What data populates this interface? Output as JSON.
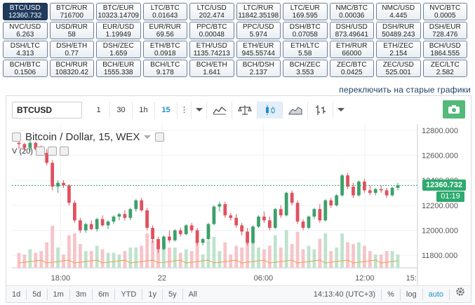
{
  "pairs": [
    [
      {
        "name": "BTC/USD",
        "value": "12360.732",
        "active": true
      },
      {
        "name": "BTC/RUR",
        "value": "716700"
      },
      {
        "name": "BTC/EUR",
        "value": "10323.14709"
      },
      {
        "name": "LTC/BTC",
        "value": "0.01643"
      },
      {
        "name": "LTC/USD",
        "value": "202.474"
      },
      {
        "name": "LTC/RUR",
        "value": "11842.35198"
      },
      {
        "name": "LTC/EUR",
        "value": "169.595"
      },
      {
        "name": "NMC/BTC",
        "value": "0.00036"
      },
      {
        "name": "NMC/USD",
        "value": "4.445"
      },
      {
        "name": "NVC/BTC",
        "value": "0.0005"
      }
    ],
    [
      {
        "name": "NVC/USD",
        "value": "6.263"
      },
      {
        "name": "USD/RUR",
        "value": "58"
      },
      {
        "name": "EUR/USD",
        "value": "1.19949"
      },
      {
        "name": "EUR/RUR",
        "value": "69.56"
      },
      {
        "name": "PPC/BTC",
        "value": "0.00048"
      },
      {
        "name": "PPC/USD",
        "value": "5.974"
      },
      {
        "name": "DSH/BTC",
        "value": "0.07058"
      },
      {
        "name": "DSH/USD",
        "value": "873.49641"
      },
      {
        "name": "DSH/RUR",
        "value": "50489.243"
      },
      {
        "name": "DSH/EUR",
        "value": "728.476"
      }
    ],
    [
      {
        "name": "DSH/LTC",
        "value": "4.313"
      },
      {
        "name": "DSH/ETH",
        "value": "0.77"
      },
      {
        "name": "DSH/ZEC",
        "value": "1.659"
      },
      {
        "name": "ETH/BTC",
        "value": "0.0918"
      },
      {
        "name": "ETH/USD",
        "value": "1135.74213"
      },
      {
        "name": "ETH/EUR",
        "value": "945.55744"
      },
      {
        "name": "ETH/LTC",
        "value": "5.58"
      },
      {
        "name": "ETH/RUR",
        "value": "66000"
      },
      {
        "name": "ETH/ZEC",
        "value": "2.154"
      },
      {
        "name": "BCH/USD",
        "value": "1864.555"
      }
    ],
    [
      {
        "name": "BCH/BTC",
        "value": "0.1506"
      },
      {
        "name": "BCH/RUR",
        "value": "108320.42"
      },
      {
        "name": "BCH/EUR",
        "value": "1555.338"
      },
      {
        "name": "BCH/LTC",
        "value": "9.178"
      },
      {
        "name": "BCH/ETH",
        "value": "1.641"
      },
      {
        "name": "BCH/DSH",
        "value": "2.137"
      },
      {
        "name": "BCH/ZEC",
        "value": "3.553"
      },
      {
        "name": "ZEC/BTC",
        "value": "0.0425"
      },
      {
        "name": "ZEC/USD",
        "value": "525.001"
      },
      {
        "name": "ZEC/LTC",
        "value": "2.582"
      }
    ]
  ],
  "old_charts_link": "переключить на старые графики",
  "toolbar": {
    "symbol": "BTCUSD",
    "intervals": [
      "1",
      "30",
      "1h",
      "15"
    ],
    "selected_interval": "15",
    "dots": "⋮"
  },
  "legend": {
    "title": "Bitcoin / Dollar, 15, WEX",
    "sub": "V (20)"
  },
  "price_axis": {
    "ticks": [
      "12800.000",
      "12600.000",
      "12400.000",
      "12200.000",
      "12000.000",
      "11800.000"
    ],
    "current_price": "12360.732",
    "countdown": "01:19"
  },
  "time_axis": {
    "ticks": [
      "18:00",
      "22",
      "06:00",
      "12:00",
      "15:"
    ]
  },
  "bottom_bar": {
    "ranges": [
      "1d",
      "5d",
      "1m",
      "3m",
      "6m",
      "YTD",
      "1y",
      "5y",
      "All"
    ],
    "clock": "14:13:40 (UTC+3)",
    "percent": "%",
    "log": "log",
    "auto": "auto"
  },
  "colors": {
    "up": "#3da06a",
    "down": "#e0515e",
    "accent": "#1e90c8",
    "active_pair": "#1f3b5e"
  },
  "chart_data": {
    "type": "candlestick",
    "ylim": [
      11700,
      12850
    ],
    "candles": [
      [
        12700,
        12720,
        12650,
        12690
      ],
      [
        12690,
        12700,
        12640,
        12660
      ],
      [
        12660,
        12720,
        12630,
        12700
      ],
      [
        12700,
        12710,
        12640,
        12650
      ],
      [
        12650,
        12680,
        12600,
        12620
      ],
      [
        12620,
        12650,
        12520,
        12540
      ],
      [
        12540,
        12560,
        12320,
        12350
      ],
      [
        12350,
        12400,
        12300,
        12380
      ],
      [
        12380,
        12400,
        12340,
        12360
      ],
      [
        12360,
        12370,
        12200,
        12220
      ],
      [
        12220,
        12240,
        12060,
        12080
      ],
      [
        12080,
        12100,
        11980,
        12000
      ],
      [
        12000,
        12060,
        11980,
        12050
      ],
      [
        12050,
        12080,
        12000,
        12010
      ],
      [
        12010,
        12100,
        11990,
        12090
      ],
      [
        12090,
        12120,
        12030,
        12040
      ],
      [
        12040,
        12080,
        12010,
        12070
      ],
      [
        12070,
        12120,
        12050,
        12110
      ],
      [
        12110,
        12140,
        12080,
        12130
      ],
      [
        12130,
        12160,
        12080,
        12100
      ],
      [
        12100,
        12180,
        12080,
        12170
      ],
      [
        12170,
        12250,
        12150,
        12240
      ],
      [
        12240,
        12260,
        12150,
        12160
      ],
      [
        12160,
        12180,
        12000,
        12020
      ],
      [
        12020,
        12040,
        11900,
        11930
      ],
      [
        11930,
        11950,
        11820,
        11850
      ],
      [
        11850,
        11960,
        11840,
        11950
      ],
      [
        11950,
        12000,
        11900,
        11920
      ],
      [
        11920,
        12010,
        11910,
        12000
      ],
      [
        12000,
        12020,
        11950,
        11970
      ],
      [
        11970,
        12050,
        11960,
        12040
      ],
      [
        12040,
        12060,
        11980,
        12000
      ],
      [
        12000,
        12020,
        11880,
        11900
      ],
      [
        11900,
        11940,
        11880,
        11930
      ],
      [
        11930,
        12060,
        11920,
        12050
      ],
      [
        12050,
        12200,
        12040,
        12190
      ],
      [
        12190,
        12230,
        12150,
        12210
      ],
      [
        12210,
        12230,
        12100,
        12120
      ],
      [
        12120,
        12140,
        12080,
        12100
      ],
      [
        12100,
        12130,
        12020,
        12040
      ],
      [
        12040,
        12060,
        11960,
        11990
      ],
      [
        11990,
        12020,
        11880,
        11900
      ],
      [
        11900,
        12040,
        11890,
        12030
      ],
      [
        12030,
        12120,
        12020,
        12110
      ],
      [
        12110,
        12150,
        12060,
        12080
      ],
      [
        12080,
        12110,
        12000,
        12020
      ],
      [
        12020,
        12180,
        12010,
        12170
      ],
      [
        12170,
        12200,
        12100,
        12120
      ],
      [
        12120,
        12310,
        12110,
        12300
      ],
      [
        12300,
        12320,
        12200,
        12220
      ],
      [
        12220,
        12240,
        12050,
        12070
      ],
      [
        12070,
        12090,
        12000,
        12020
      ],
      [
        12020,
        12120,
        12010,
        12110
      ],
      [
        12110,
        12180,
        12090,
        12170
      ],
      [
        12170,
        12210,
        12060,
        12080
      ],
      [
        12080,
        12250,
        12070,
        12240
      ],
      [
        12240,
        12260,
        12180,
        12200
      ],
      [
        12200,
        12290,
        12190,
        12280
      ],
      [
        12280,
        12450,
        12270,
        12440
      ],
      [
        12440,
        12460,
        12330,
        12350
      ],
      [
        12350,
        12380,
        12260,
        12280
      ],
      [
        12280,
        12400,
        12270,
        12390
      ],
      [
        12390,
        12410,
        12300,
        12320
      ],
      [
        12320,
        12360,
        12280,
        12300
      ],
      [
        12300,
        12340,
        12280,
        12330
      ],
      [
        12330,
        12360,
        12300,
        12320
      ],
      [
        12320,
        12340,
        12260,
        12280
      ],
      [
        12280,
        12350,
        12270,
        12340
      ],
      [
        12340,
        12380,
        12320,
        12360
      ]
    ]
  }
}
